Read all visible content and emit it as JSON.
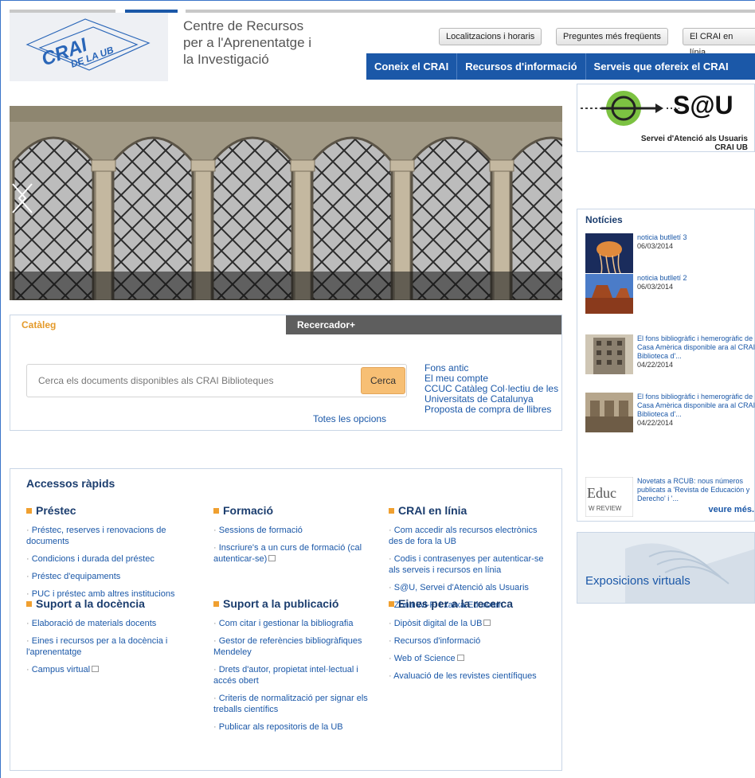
{
  "header": {
    "logo_text_1": "CRAI",
    "logo_text_2": "DE LA UB",
    "title_line1": "Centre de Recursos",
    "title_line2": "per a l'Aprenentatge i",
    "title_line3": "la Investigació",
    "util_links": [
      "Localitzacions i horaris",
      "Preguntes més freqüents",
      "El CRAI en línia"
    ],
    "nav": [
      "Coneix el CRAI",
      "Recursos d'informació",
      "Serveis que ofereix el CRAI"
    ]
  },
  "slider": {
    "prev_icon": "chevron-left-icon",
    "next_icon": "chevron-right-icon"
  },
  "search": {
    "tabs": [
      "Catàleg",
      "Recercador+"
    ],
    "placeholder": "Cerca els documents disponibles als CRAI Biblioteques",
    "button": "Cerca",
    "all_options": "Totes les opcions",
    "links": [
      "Fons antic",
      "El meu compte",
      "CCUC Catàleg Col·lectiu de les Universitats de Catalunya",
      "Proposta de compra de llibres"
    ]
  },
  "quick_access": {
    "title": "Accessos ràpids",
    "sections": [
      {
        "title": "Préstec",
        "links": [
          "Préstec, reserves i renovacions de documents",
          "Condicions i durada del préstec",
          "Préstec d'equipaments",
          "PUC i préstec amb altres institucions"
        ]
      },
      {
        "title": "Formació",
        "links": [
          "Sessions de formació",
          "Inscriure's a un curs de formació (cal autenticar-se)"
        ]
      },
      {
        "title": "CRAI en línia",
        "links": [
          "Com accedir als recursos electrònics des de fora la UB",
          "Codis i contrasenyes per autenticar-se als serveis i recursos en línia",
          "S@U, Servei d'Atenció als Usuaris",
          "Zona Wi-Fi i xarxa Eduroam"
        ]
      },
      {
        "title": "Suport a la docència",
        "links": [
          "Elaboració de materials docents",
          "Eines i recursos per a la docència i l'aprenentatge",
          "Campus virtual"
        ]
      },
      {
        "title": "Suport a la publicació",
        "links": [
          "Com citar i gestionar la bibliografia",
          "Gestor de referències bibliogràfiques Mendeley",
          "Drets d'autor, propietat intel·lectual i accés obert",
          "Criteris de normalització per signar els treballs científics",
          "Publicar als repositoris de la UB"
        ]
      },
      {
        "title": "Eines per a la recerca",
        "links": [
          "Dipòsit digital de la UB",
          "Recursos d'informació",
          "Web of Science",
          "Avaluació de les revistes científiques"
        ]
      }
    ]
  },
  "sau": {
    "big": "S@U",
    "line1": "Servei d'Atenció als Usuaris",
    "line2": "CRAI UB"
  },
  "news": {
    "title": "Notícies",
    "items": [
      {
        "text": "noticia butlletí 3",
        "date": "06/03/2014"
      },
      {
        "text": "noticia butlletí 2",
        "date": "06/03/2014"
      },
      {
        "text": "El fons bibliogràfic i hemerogràfic de Casa Amèrica disponible ara al CRAI Biblioteca d'...",
        "date": "04/22/2014"
      },
      {
        "text": "El fons bibliogràfic i hemerogràfic de Casa Amèrica disponible ara al CRAI Biblioteca d'...",
        "date": "04/22/2014"
      },
      {
        "text": "Novetats a RCUB: nous números publicats a 'Revista de Educación y Derecho' i '...",
        "date": ""
      }
    ],
    "more": "veure més."
  },
  "expo": {
    "label": "Exposicions virtuals"
  }
}
